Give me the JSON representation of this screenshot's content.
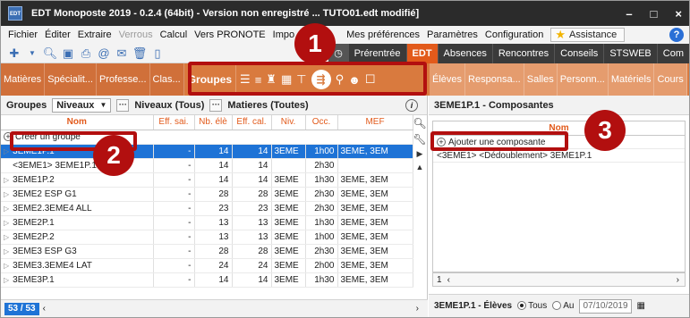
{
  "window": {
    "title": "EDT Monoposte 2019 - 0.2.4 (64bit) - Version non enregistré ... TUTO01.edt modifié]",
    "app_icon": "EDT",
    "minimize": "–",
    "maximize": "□",
    "close": "×"
  },
  "menu": {
    "items": [
      "Fichier",
      "Éditer",
      "Extraire",
      "Verrous",
      "Calcul",
      "Vers PRONOTE",
      "Impo",
      "Mes préférences",
      "Paramètres",
      "Configuration"
    ],
    "assistance": "Assistance",
    "help": "?"
  },
  "toolbar": {
    "icons": [
      "new-file-icon",
      "search-icon",
      "save-icon",
      "print-icon",
      "email-icon",
      "mail-icon",
      "trash-icon",
      "export-icon"
    ],
    "modes": {
      "prerentree": "Prérentrée",
      "edt": "EDT"
    },
    "right_tabs": [
      "Absences",
      "Rencontres",
      "Conseils",
      "STSWEB",
      "Com"
    ]
  },
  "nav": {
    "left_items": [
      "Matières",
      "Spécialit...",
      "Professe...",
      "Clas..."
    ],
    "active": "Groupes",
    "right_items": [
      "Élèves",
      "Responsa...",
      "Salles",
      "Personn...",
      "Matériels",
      "Cours"
    ]
  },
  "left": {
    "header_title": "Groupes",
    "filter_value": "Niveaux",
    "filter_summary": "Niveaux (Tous)",
    "matieres_summary": "Matieres (Toutes)",
    "columns": [
      "Nom",
      "Eff. sai.",
      "Nb. élè",
      "Eff. cal.",
      "Niv.",
      "Occ.",
      "MEF"
    ],
    "create_label": "Créer un groupe",
    "rows": [
      {
        "nom": "3EME1P.1",
        "eff_sai": "-",
        "nb": "14",
        "eff_cal": "14",
        "niv": "3EME",
        "occ": "1h00",
        "mef": "3EME, 3EM",
        "selected": true
      },
      {
        "nom": "<3EME1> 3EME1P.1",
        "eff_sai": "-",
        "nb": "14",
        "eff_cal": "14",
        "niv": "",
        "occ": "2h30",
        "mef": "",
        "selected": false
      },
      {
        "nom": "3EME1P.2",
        "eff_sai": "-",
        "nb": "14",
        "eff_cal": "14",
        "niv": "3EME",
        "occ": "1h30",
        "mef": "3EME, 3EM",
        "selected": false
      },
      {
        "nom": "3EME2 ESP G1",
        "eff_sai": "-",
        "nb": "28",
        "eff_cal": "28",
        "niv": "3EME",
        "occ": "2h30",
        "mef": "3EME, 3EM",
        "selected": false
      },
      {
        "nom": "3EME2.3EME4 ALL",
        "eff_sai": "-",
        "nb": "23",
        "eff_cal": "23",
        "niv": "3EME",
        "occ": "2h30",
        "mef": "3EME, 3EM",
        "selected": false
      },
      {
        "nom": "3EME2P.1",
        "eff_sai": "-",
        "nb": "13",
        "eff_cal": "13",
        "niv": "3EME",
        "occ": "1h30",
        "mef": "3EME, 3EM",
        "selected": false
      },
      {
        "nom": "3EME2P.2",
        "eff_sai": "-",
        "nb": "13",
        "eff_cal": "13",
        "niv": "3EME",
        "occ": "1h00",
        "mef": "3EME, 3EM",
        "selected": false
      },
      {
        "nom": "3EME3 ESP G3",
        "eff_sai": "-",
        "nb": "28",
        "eff_cal": "28",
        "niv": "3EME",
        "occ": "2h30",
        "mef": "3EME, 3EM",
        "selected": false
      },
      {
        "nom": "3EME3.3EME4 LAT",
        "eff_sai": "-",
        "nb": "24",
        "eff_cal": "24",
        "niv": "3EME",
        "occ": "2h00",
        "mef": "3EME, 3EM",
        "selected": false
      },
      {
        "nom": "3EME3P.1",
        "eff_sai": "-",
        "nb": "14",
        "eff_cal": "14",
        "niv": "3EME",
        "occ": "1h30",
        "mef": "3EME, 3EM",
        "selected": false
      }
    ],
    "count": "53 / 53"
  },
  "right": {
    "header_title": "3EME1P.1 - Composantes",
    "column": "Nom",
    "add_label": "Ajouter une composante",
    "rows": [
      "<3EME1> <Dédoublement> 3EME1P.1"
    ],
    "hscroll_value": "1",
    "footer_title": "3EME1P.1 - Élèves",
    "opt_tous": "Tous",
    "opt_au": "Au",
    "date": "07/10/2019"
  },
  "callouts": {
    "one": "1",
    "two": "2",
    "three": "3"
  },
  "colors": {
    "accent": "#d97a3e",
    "edt_tab": "#e25a1b",
    "selection": "#1e73d6",
    "callout": "#b20f0f"
  }
}
